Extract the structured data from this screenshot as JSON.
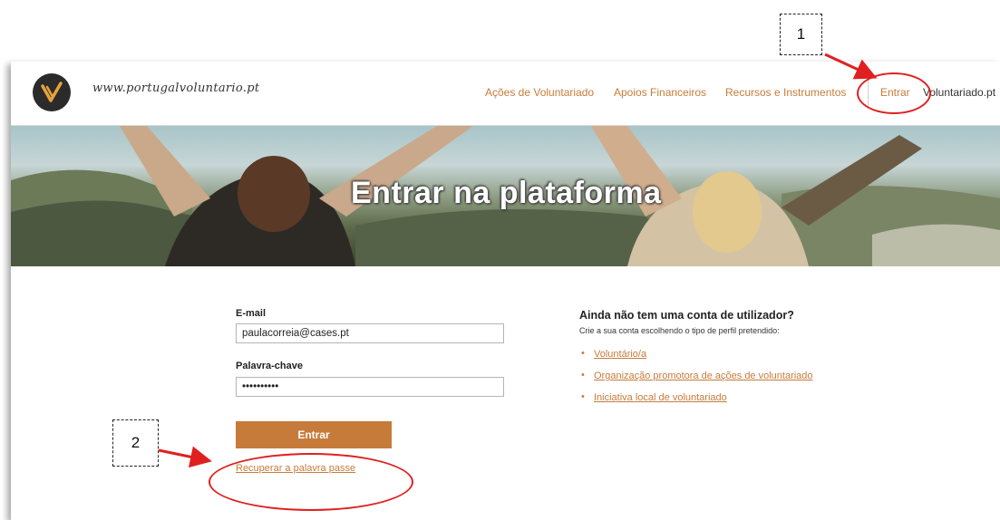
{
  "header": {
    "logo_text": "www.portugalvoluntario.pt",
    "nav": [
      "Ações de Voluntariado",
      "Apoios Financeiros",
      "Recursos e Instrumentos"
    ],
    "login_link": "Entrar",
    "external_link": "Voluntariado.pt"
  },
  "hero": {
    "title": "Entrar na plataforma"
  },
  "login_form": {
    "email_label": "E-mail",
    "email_value": "paulacorreia@cases.pt",
    "password_label": "Palavra-chave",
    "password_value": "••••••••••",
    "submit_label": "Entrar",
    "recover_link": "Recuperar a palavra passe"
  },
  "signup": {
    "title": "Ainda não tem uma conta de utilizador?",
    "subtitle": "Crie a sua conta escolhendo o tipo de perfil pretendido:",
    "options": [
      "Voluntário/a",
      "Organização promotora de ações de voluntariado",
      "Iniciativa local de voluntariado"
    ]
  },
  "annotations": {
    "marker_1": "1",
    "marker_2": "2",
    "highlight_color": "#e02020"
  },
  "colors": {
    "accent": "#c77b3a"
  }
}
